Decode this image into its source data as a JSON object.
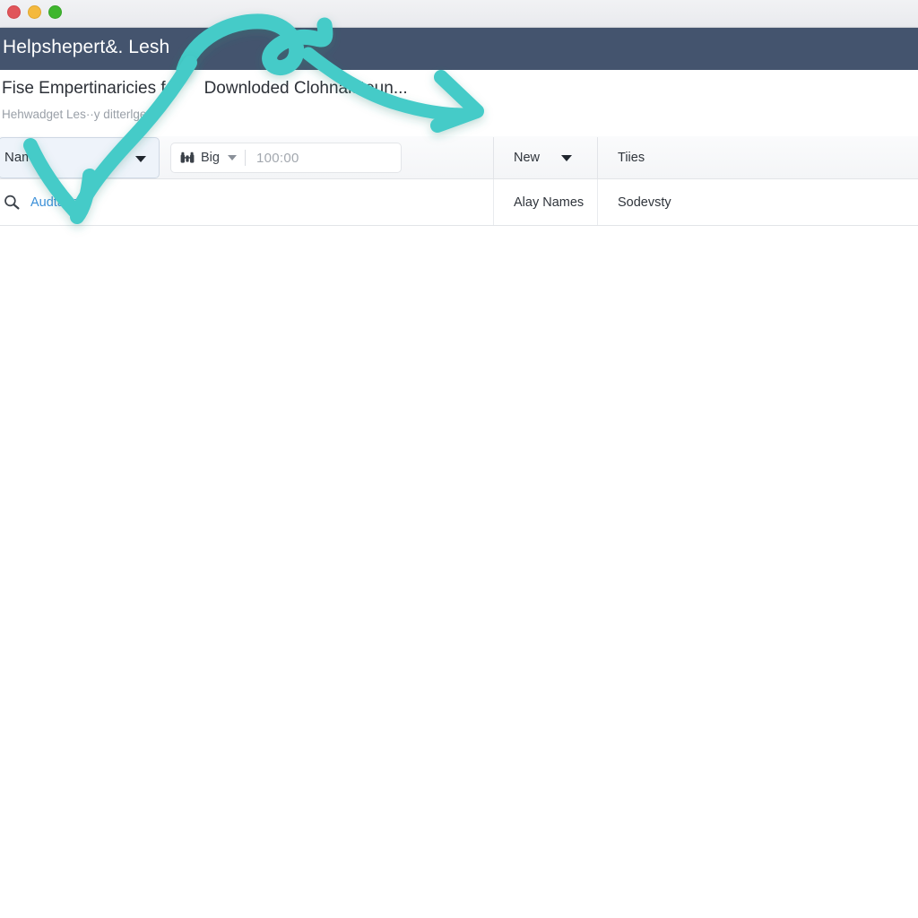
{
  "window": {
    "traffic_lights": [
      {
        "name": "close",
        "color": "#e0555a"
      },
      {
        "name": "minimize",
        "color": "#f4b93e"
      },
      {
        "name": "zoom",
        "color": "#3fb62e"
      }
    ]
  },
  "navbar": {
    "title": "Helpshepert&. Lesh",
    "background": "#44546e"
  },
  "header": {
    "title_part1": "Fise Empertinaricies fo·",
    "title_part2": "Downloded Clohnalsteun...",
    "subtitle": "Hehwadget Les··y ditterlges"
  },
  "toolbar": {
    "select": {
      "label": "Name·",
      "icon": "chevron-down-icon"
    },
    "input": {
      "icon": "binoculars-icon",
      "unit": "Big",
      "unit_caret": "chevron-down-icon",
      "value": "100:00",
      "placeholder": "100:00"
    }
  },
  "table": {
    "columns": [
      {
        "key": "new",
        "label": "New",
        "has_caret": true
      },
      {
        "key": "tiles",
        "label": "Tiies",
        "has_caret": false
      }
    ],
    "row": {
      "search_icon": "search-icon",
      "search_link": "Audtaim",
      "new": "Alay Names",
      "tiles": "Sodevsty"
    }
  },
  "annotations": {
    "color": "#45cbc8",
    "arrows": [
      {
        "name": "arrow-to-header-right",
        "direction": "right"
      },
      {
        "name": "arrow-to-select-field",
        "direction": "down"
      }
    ]
  }
}
